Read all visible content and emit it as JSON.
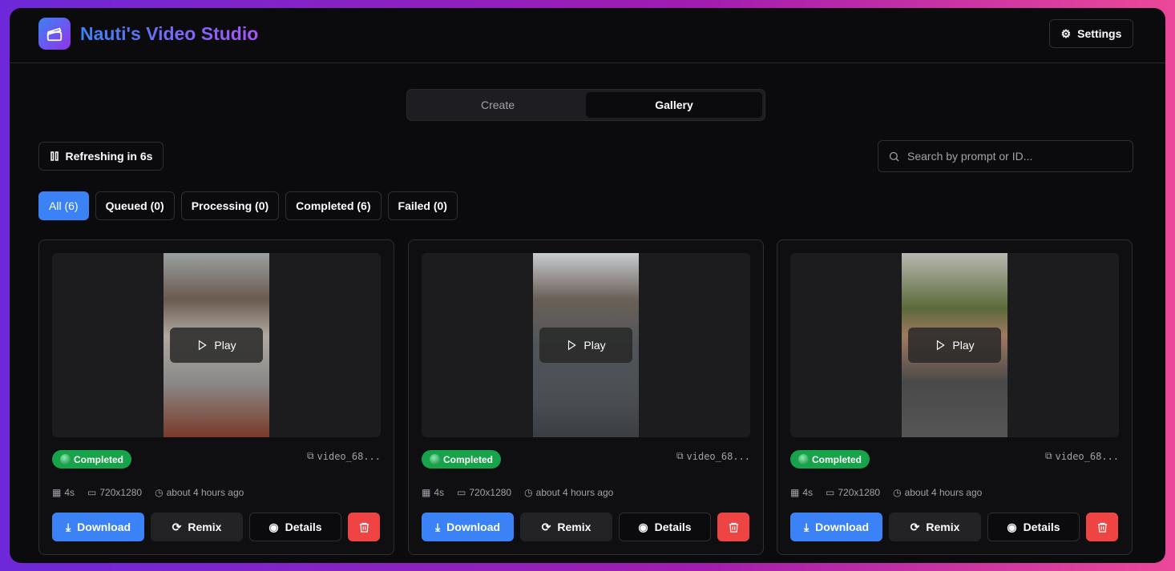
{
  "app": {
    "title": "Nauti's Video Studio",
    "settings_label": "Settings"
  },
  "tabs": [
    {
      "label": "Create"
    },
    {
      "label": "Gallery"
    }
  ],
  "refresh_label": "Refreshing in 6s",
  "search": {
    "placeholder": "Search by prompt or ID..."
  },
  "filters": [
    {
      "label": "All (6)"
    },
    {
      "label": "Queued (0)"
    },
    {
      "label": "Processing (0)"
    },
    {
      "label": "Completed (6)"
    },
    {
      "label": "Failed (0)"
    }
  ],
  "colors": {
    "accent": "#3b82f6",
    "success": "#16a34a",
    "danger": "#ef4444"
  },
  "cards": [
    {
      "play": "Play",
      "status": "Completed",
      "id": "video_68...",
      "duration": "4s",
      "resolution": "720x1280",
      "time": "about 4 hours ago",
      "download": "Download",
      "remix": "Remix",
      "details": "Details"
    },
    {
      "play": "Play",
      "status": "Completed",
      "id": "video_68...",
      "duration": "4s",
      "resolution": "720x1280",
      "time": "about 4 hours ago",
      "download": "Download",
      "remix": "Remix",
      "details": "Details"
    },
    {
      "play": "Play",
      "status": "Completed",
      "id": "video_68...",
      "duration": "4s",
      "resolution": "720x1280",
      "time": "about 4 hours ago",
      "download": "Download",
      "remix": "Remix",
      "details": "Details"
    }
  ]
}
